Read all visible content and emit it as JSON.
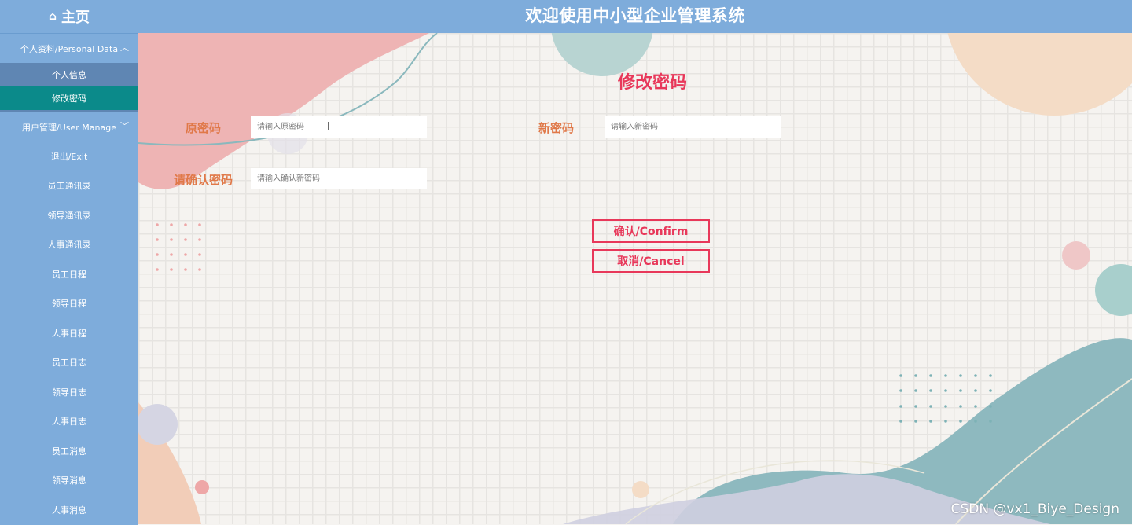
{
  "header": {
    "home_icon": "home-icon",
    "home_label": "主页",
    "app_title": "欢迎使用中小型企业管理系统"
  },
  "sidebar": {
    "groups": [
      {
        "label": "个人资料/Personal Data",
        "expanded": true,
        "items": [
          {
            "label": "个人信息"
          },
          {
            "label": "修改密码",
            "active": true
          }
        ]
      },
      {
        "label": "用户管理/User Manage",
        "expanded": false
      }
    ],
    "items": [
      {
        "label": "退出/Exit"
      },
      {
        "label": "员工通讯录"
      },
      {
        "label": "领导通讯录"
      },
      {
        "label": "人事通讯录"
      },
      {
        "label": "员工日程"
      },
      {
        "label": "领导日程"
      },
      {
        "label": "人事日程"
      },
      {
        "label": "员工日志"
      },
      {
        "label": "领导日志"
      },
      {
        "label": "人事日志"
      },
      {
        "label": "员工消息"
      },
      {
        "label": "领导消息"
      },
      {
        "label": "人事消息"
      }
    ]
  },
  "form": {
    "title": "修改密码",
    "old_password": {
      "label": "原密码",
      "placeholder": "请输入原密码",
      "value": ""
    },
    "new_password": {
      "label": "新密码",
      "placeholder": "请输入新密码",
      "value": ""
    },
    "confirm_password": {
      "label": "请确认密码",
      "placeholder": "请输入确认新密码",
      "value": ""
    },
    "confirm_button": "确认/Confirm",
    "cancel_button": "取消/Cancel"
  },
  "watermark": "CSDN @vx1_Biye_Design",
  "colors": {
    "topbar": "#7eacdb",
    "sidebar": "#7eacdb",
    "submenu": "#5f86b3",
    "active_item": "#0b8a8a",
    "accent": "#e8385a",
    "label": "#e07848",
    "background": "#f5f3f0"
  }
}
